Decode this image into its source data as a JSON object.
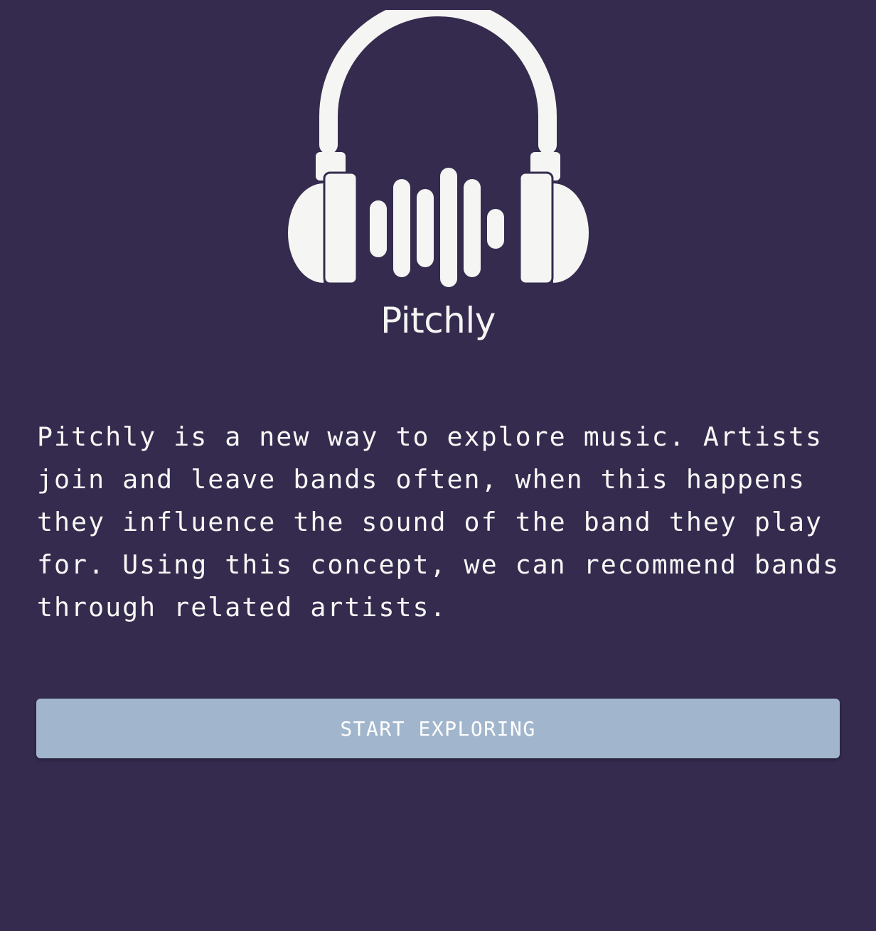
{
  "app": {
    "name": "Pitchly",
    "logo_icon": "headphones-soundwave-icon",
    "brand_color": "#352b4e",
    "logo_color": "#f5f5f3"
  },
  "intro": {
    "description": "Pitchly is a new way to explore music. Artists join and leave bands often, when this happens they influence the sound of the band they play for. Using this concept, we can recommend bands through related artists."
  },
  "actions": {
    "start_label": "START EXPLORING",
    "button_color": "#a1b6cd"
  }
}
